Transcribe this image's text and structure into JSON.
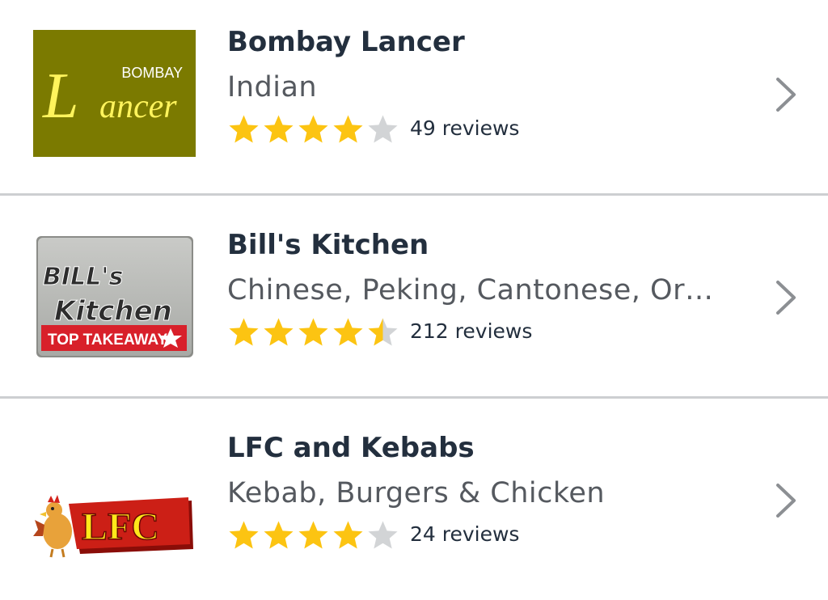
{
  "restaurants": [
    {
      "name": "Bombay Lancer",
      "cuisine": "Indian",
      "rating": 4,
      "reviews": "49 reviews",
      "logo": {
        "line1": "BOMBAY",
        "big_letter": "L",
        "rest": "ancer",
        "bg": "#7b7a00",
        "text_color": "#fff45c"
      }
    },
    {
      "name": "Bill's Kitchen",
      "cuisine": "Chinese, Peking, Cantonese, Orie…",
      "rating": 4.5,
      "reviews": "212 reviews",
      "logo": {
        "line1": "BILL's",
        "line2": "Kitchen",
        "banner": "TOP TAKEAWAY",
        "banner_color": "#d8202a"
      }
    },
    {
      "name": "LFC and Kebabs",
      "cuisine": "Kebab, Burgers & Chicken",
      "rating": 4,
      "reviews": "24 reviews",
      "logo": {
        "text": "LFC",
        "bg": "#cc1f16",
        "text_color": "#ffe81a"
      }
    }
  ],
  "colors": {
    "star_filled": "#fcc412",
    "star_empty": "#d2d4d6",
    "chevron": "#8c8f93",
    "divider": "#cdcfd1"
  },
  "icons": {
    "star": "star-icon",
    "chevron": "chevron-right-icon"
  }
}
